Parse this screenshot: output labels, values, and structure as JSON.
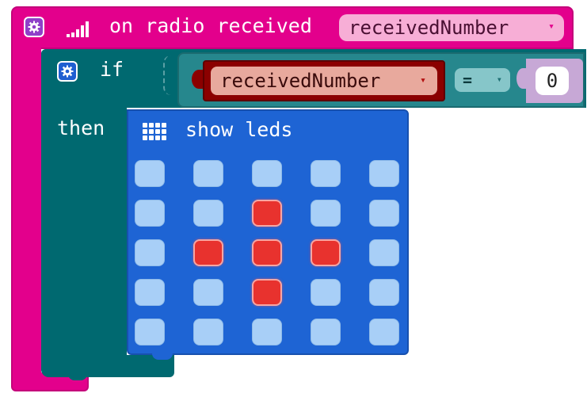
{
  "radio_event": {
    "label": "on radio received",
    "variable": "receivedNumber",
    "dropdown_arrow": "▾",
    "icons": [
      "gear-icon",
      "signal-bars-icon"
    ],
    "color": "#e3008c"
  },
  "if_block": {
    "if_label": "if",
    "then_label": "then",
    "icons": [
      "gear-icon"
    ],
    "color": "#006970"
  },
  "condition": {
    "variable": "receivedNumber",
    "variable_arrow": "▾",
    "operator": "=",
    "operator_arrow": "▾",
    "value": "0",
    "variable_color": "#8b0000"
  },
  "show_leds": {
    "label": "show leds",
    "icon": "led-grid-icon",
    "color": "#1e64d4",
    "on_color": "#e8322e",
    "off_color": "#a8cff7",
    "grid": [
      [
        0,
        0,
        0,
        0,
        0
      ],
      [
        0,
        0,
        1,
        0,
        0
      ],
      [
        0,
        1,
        1,
        1,
        0
      ],
      [
        0,
        0,
        1,
        0,
        0
      ],
      [
        0,
        0,
        0,
        0,
        0
      ]
    ]
  }
}
